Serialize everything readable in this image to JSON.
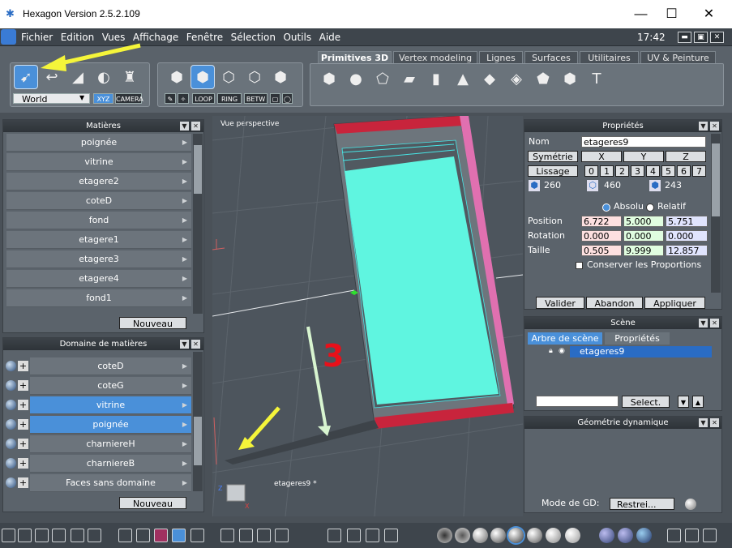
{
  "window": {
    "title": "Hexagon Version 2.5.2.109",
    "minimize": "—",
    "maximize": "☐",
    "close": "✕"
  },
  "menu": {
    "items": [
      "Fichier",
      "Edition",
      "Vues",
      "Affichage",
      "Fenêtre",
      "Sélection",
      "Outils",
      "Aide"
    ],
    "clock": "17:42"
  },
  "toolbar": {
    "space_select": "World",
    "xyz": "XYZ",
    "camera": "CAMERA",
    "loop": "LOOP",
    "ring": "RING",
    "betw": "BETW",
    "tabs": [
      "Primitives 3D",
      "Vertex modeling",
      "Lignes",
      "Surfaces",
      "Utilitaires",
      "UV & Peinture"
    ],
    "active_tab": "Primitives 3D"
  },
  "materials": {
    "title": "Matières",
    "items": [
      "poignée",
      "vitrine",
      "etagere2",
      "coteD",
      "fond",
      "etagere1",
      "etagere3",
      "etagere4",
      "fond1"
    ],
    "new_button": "Nouveau"
  },
  "material_domain": {
    "title": "Domaine de matières",
    "items": [
      {
        "label": "coteD",
        "highlighted": false
      },
      {
        "label": "coteG",
        "highlighted": false
      },
      {
        "label": "vitrine",
        "highlighted": true
      },
      {
        "label": "poignée",
        "highlighted": true
      },
      {
        "label": "charniereH",
        "highlighted": false
      },
      {
        "label": "charniereB",
        "highlighted": false
      },
      {
        "label": "Faces sans domaine",
        "highlighted": false
      }
    ],
    "new_button": "Nouveau"
  },
  "viewport": {
    "label": "Vue perspective",
    "object_label": "etageres9 *",
    "annotation": "3"
  },
  "properties": {
    "title": "Propriétés",
    "name_label": "Nom",
    "name_value": "etageres9",
    "symmetry_button": "Symétrie",
    "axes": [
      "X",
      "Y",
      "Z"
    ],
    "smoothing_button": "Lissage",
    "smoothing_levels": [
      "0",
      "1",
      "2",
      "3",
      "4",
      "5",
      "6",
      "7"
    ],
    "counts": [
      "260",
      "460",
      "243"
    ],
    "absolute": "Absolu",
    "relative": "Relatif",
    "position_label": "Position",
    "position": [
      "6.722",
      "5.000",
      "5.751"
    ],
    "rotation_label": "Rotation",
    "rotation": [
      "0.000",
      "0.000",
      "0.000"
    ],
    "size_label": "Taille",
    "size": [
      "0.505",
      "9.999",
      "12.857"
    ],
    "keep_proportions": "Conserver les Proportions",
    "validate": "Valider",
    "abandon": "Abandon",
    "apply": "Appliquer"
  },
  "scene": {
    "title": "Scène",
    "tabs": [
      "Arbre de scène",
      "Propriétés"
    ],
    "tree_item": "etageres9",
    "select_button": "Select."
  },
  "dynamic_geometry": {
    "title": "Géométrie dynamique",
    "mode_label": "Mode de GD:",
    "mode_value": "Restrei..."
  },
  "colors": {
    "accent": "#4a90d9",
    "annotation_red": "#e8101a",
    "arrow_yellow": "#f5f53a",
    "arrow_green": "#d8f5d0",
    "cyan_face": "#5ff5e0"
  }
}
